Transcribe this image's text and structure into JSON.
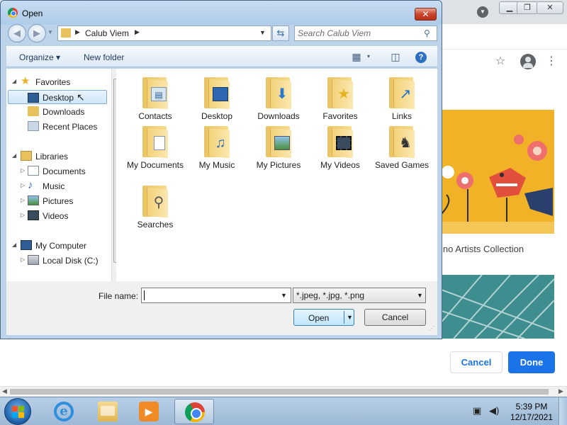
{
  "dialog": {
    "title": "Open",
    "close_glyph": "✕",
    "address": {
      "segment": "Calub Viem"
    },
    "search": {
      "placeholder": "Search Calub Viem"
    },
    "toolbar": {
      "organize": "Organize",
      "new_folder": "New folder"
    },
    "nav": {
      "favorites": "Favorites",
      "favorites_items": [
        "Desktop",
        "Downloads",
        "Recent Places"
      ],
      "libraries": "Libraries",
      "libraries_items": [
        "Documents",
        "Music",
        "Pictures",
        "Videos"
      ],
      "computer": "My Computer",
      "computer_items": [
        "Local Disk (C:)"
      ],
      "selected": "Desktop"
    },
    "folders": [
      {
        "label": "Contacts",
        "icon": "contacts-icon"
      },
      {
        "label": "Desktop",
        "icon": "desktop-icon"
      },
      {
        "label": "Downloads",
        "icon": "downloads-icon"
      },
      {
        "label": "Favorites",
        "icon": "favorites-star-icon"
      },
      {
        "label": "Links",
        "icon": "links-icon"
      },
      {
        "label": "My Documents",
        "icon": "documents-icon"
      },
      {
        "label": "My Music",
        "icon": "music-note-icon"
      },
      {
        "label": "My Pictures",
        "icon": "pictures-icon"
      },
      {
        "label": "My Videos",
        "icon": "videos-icon"
      },
      {
        "label": "Saved Games",
        "icon": "chess-piece-icon"
      },
      {
        "label": "Searches",
        "icon": "magnifier-icon"
      }
    ],
    "file_name_label": "File name:",
    "file_name_value": "",
    "file_type": "*.jpeg, *.jpg, *.png",
    "open_label": "Open",
    "cancel_label": "Cancel"
  },
  "chrome": {
    "caption": "ino Artists Collection",
    "cancel_label": "Cancel",
    "done_label": "Done",
    "accent": "#1a73e8"
  },
  "taskbar": {
    "time": "5:39 PM",
    "date": "12/17/2021"
  }
}
